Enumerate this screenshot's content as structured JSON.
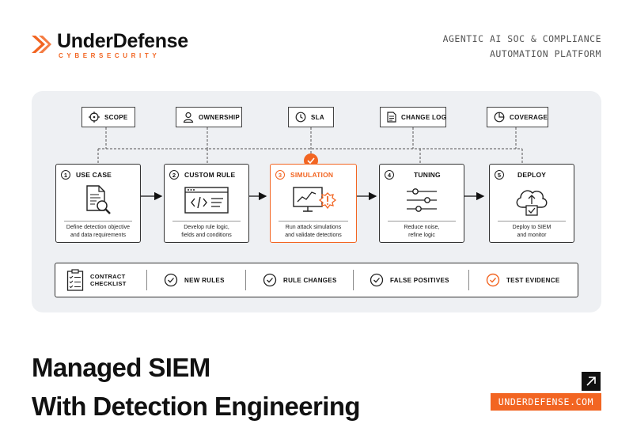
{
  "brand": {
    "name": "UnderDefense",
    "subtitle": "CYBERSECURITY",
    "tagline": [
      "AGENTIC AI SOC & COMPLIANCE",
      "AUTOMATION PLATFORM"
    ],
    "accent_color": "#f26522"
  },
  "diagram": {
    "top_labels": [
      {
        "label": "SCOPE",
        "icon": "crosshair-icon"
      },
      {
        "label": "OWNERSHIP",
        "icon": "user-icon"
      },
      {
        "label": "SLA",
        "icon": "clock-icon"
      },
      {
        "label": "CHANGE LOG",
        "icon": "document-icon"
      },
      {
        "label": "COVERAGE",
        "icon": "pie-chart-icon"
      }
    ],
    "steps": [
      {
        "number": "1",
        "title": "USE CASE",
        "desc_line1": "Define detection objective",
        "desc_line2": "and data requirements",
        "icon": "document-search-icon"
      },
      {
        "number": "2",
        "title": "CUSTOM RULE",
        "desc_line1": "Develop rule logic,",
        "desc_line2": "fields and conditions",
        "icon": "code-window-icon"
      },
      {
        "number": "3",
        "title": "SIMULATION",
        "desc_line1": "Run attack simulations",
        "desc_line2": "and validate detections",
        "icon": "monitor-alert-icon",
        "active": true
      },
      {
        "number": "4",
        "title": "TUNING",
        "desc_line1": "Reduce noise,",
        "desc_line2": "refine logic",
        "icon": "sliders-icon"
      },
      {
        "number": "5",
        "title": "DEPLOY",
        "desc_line1": "Deploy to SIEM",
        "desc_line2": "and monitor",
        "icon": "cloud-upload-icon"
      }
    ],
    "checklist": {
      "label_line1": "CONTRACT",
      "label_line2": "CHECKLIST",
      "items": [
        {
          "label": "NEW RULES",
          "highlight": false
        },
        {
          "label": "RULE CHANGES",
          "highlight": false
        },
        {
          "label": "FALSE POSITIVES",
          "highlight": false
        },
        {
          "label": "TEST EVIDENCE",
          "highlight": true
        }
      ]
    }
  },
  "headline": {
    "line1": "Managed SIEM",
    "line2": "With Detection Engineering"
  },
  "cta": {
    "url_label": "UNDERDEFENSE.COM"
  }
}
